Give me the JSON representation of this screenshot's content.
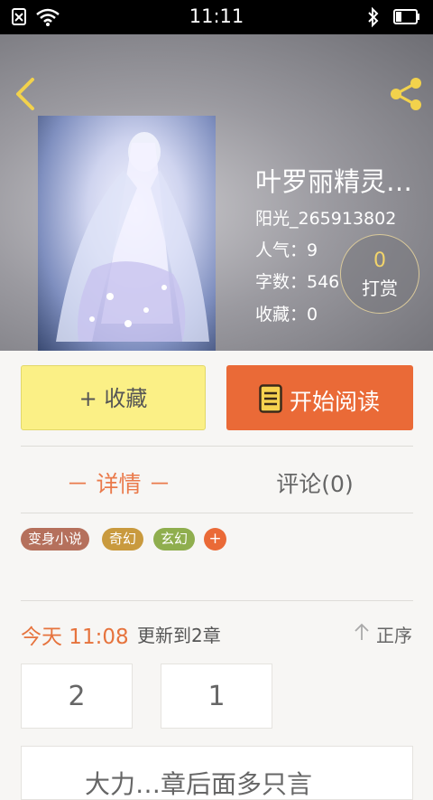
{
  "status_bar": {
    "time": "11:11"
  },
  "book": {
    "title": "叶罗丽精灵…",
    "author": "阳光_265913802",
    "popularity": "人气：9",
    "words": "字数：546",
    "favorites": "收藏：0"
  },
  "tip": {
    "count": "0",
    "label": "打赏"
  },
  "actions": {
    "favorite_label": "+ 收藏",
    "read_label": "开始阅读"
  },
  "tabs": {
    "detail": "－ 详情 －",
    "comments": "评论(0)"
  },
  "tags": [
    "变身小说",
    "奇幻",
    "玄幻"
  ],
  "tag_add": "+",
  "update": {
    "time": "今天 11:08",
    "text": "更新到2章",
    "sort": "正序"
  },
  "chapters": [
    "2",
    "1"
  ],
  "bottom_card": {
    "text": "大力…章后面多只言"
  },
  "colors": {
    "accent": "#ea6a37",
    "favorite_button": "#fbf086",
    "detail_tab": "#ea7a4b"
  }
}
